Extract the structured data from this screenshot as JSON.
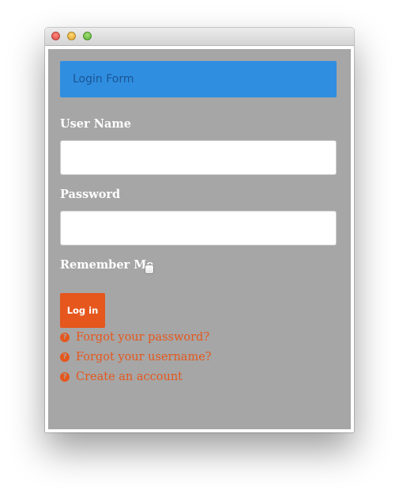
{
  "window": {
    "controls": [
      "close-icon",
      "minimize-icon",
      "maximize-icon"
    ]
  },
  "form": {
    "title": "Login Form",
    "username": {
      "label": "User Name",
      "value": "",
      "placeholder": ""
    },
    "password": {
      "label": "Password",
      "value": "",
      "placeholder": ""
    },
    "remember": {
      "label": "Remember Me",
      "checked": false
    },
    "submit_label": "Log in"
  },
  "links": [
    {
      "icon": "question-icon",
      "glyph": "?",
      "label": "Forgot your password?"
    },
    {
      "icon": "question-icon",
      "glyph": "?",
      "label": "Forgot your username?"
    },
    {
      "icon": "question-icon",
      "glyph": "?",
      "label": "Create an account"
    }
  ],
  "colors": {
    "header_bg": "#308ee0",
    "accent": "#e5571d",
    "panel_bg": "#a6a6a6"
  }
}
